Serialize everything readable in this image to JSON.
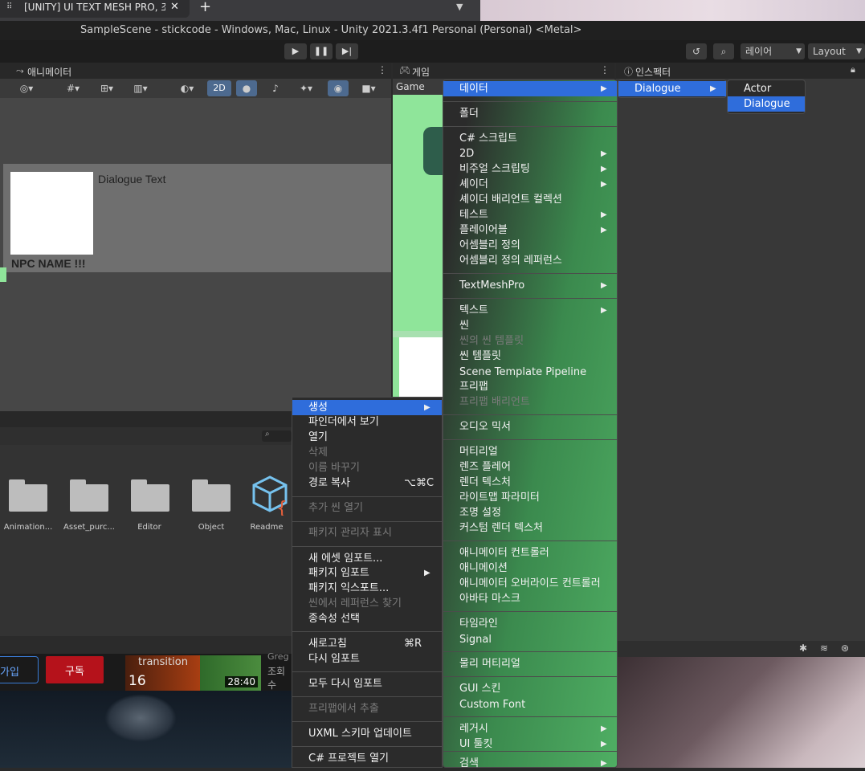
{
  "browser": {
    "tab_title": "[UNITY] UI TEXT MESH PRO, 조",
    "close_glyph": "✕",
    "new_tab_glyph": "+"
  },
  "window": {
    "title": "SampleScene - stickcode - Windows, Mac, Linux - Unity 2021.3.4f1 Personal (Personal) <Metal>"
  },
  "toolbar": {
    "layers_label": "레이어",
    "layout_label": "Layout"
  },
  "panels": {
    "animator_tab": "애니메이터",
    "game_tab": "게임",
    "game_sub": "Game",
    "inspector_tab": "인스펙터",
    "scene_2d": "2D"
  },
  "scene": {
    "dialogue_text": "Dialogue Text",
    "npc_name": "NPC NAME !!!"
  },
  "project": {
    "items": [
      {
        "label": "Animation..."
      },
      {
        "label": "Asset_purc..."
      },
      {
        "label": "Editor"
      },
      {
        "label": "Object"
      },
      {
        "label": "Readme"
      }
    ]
  },
  "video_strip": {
    "join": "가입",
    "subscribe": "구독",
    "transition": "transition",
    "count": "16",
    "duration": "28:40",
    "views": "조회수",
    "author": "Greg"
  },
  "context_menu": {
    "items": [
      {
        "label": "생성",
        "highlight": true,
        "arrow": true
      },
      {
        "label": "파인더에서 보기"
      },
      {
        "label": "열기"
      },
      {
        "label": "삭제",
        "disabled": true
      },
      {
        "label": "이름 바꾸기",
        "disabled": true
      },
      {
        "label": "경로 복사",
        "shortcut": "⌥⌘C"
      },
      {
        "label": "추가 씬 열기",
        "disabled": true
      },
      {
        "label": "패키지 관리자 표시",
        "disabled": true
      },
      {
        "label": "새 에셋 임포트..."
      },
      {
        "label": "패키지 임포트",
        "arrow": true
      },
      {
        "label": "패키지 익스포트..."
      },
      {
        "label": "씬에서 레퍼런스 찾기",
        "disabled": true
      },
      {
        "label": "종속성 선택"
      },
      {
        "label": "새로고침",
        "shortcut": "⌘R"
      },
      {
        "label": "다시 임포트"
      },
      {
        "label": "모두 다시 임포트"
      },
      {
        "label": "프리팹에서 추출",
        "disabled": true
      },
      {
        "label": "UXML 스키마 업데이트"
      },
      {
        "label": "C# 프로젝트 열기"
      }
    ]
  },
  "create_menu": {
    "items": [
      {
        "label": "데이터",
        "highlight": true,
        "arrow": true
      },
      {
        "label": "폴더"
      },
      {
        "label": "C# 스크립트"
      },
      {
        "label": "2D",
        "arrow": true
      },
      {
        "label": "비주얼 스크립팅",
        "arrow": true
      },
      {
        "label": "셰이더",
        "arrow": true
      },
      {
        "label": "셰이더 배리언트 컬렉션"
      },
      {
        "label": "테스트",
        "arrow": true
      },
      {
        "label": "플레이어블",
        "arrow": true
      },
      {
        "label": "어셈블리 정의"
      },
      {
        "label": "어셈블리 정의 레퍼런스"
      },
      {
        "label": "TextMeshPro",
        "arrow": true
      },
      {
        "label": "텍스트",
        "arrow": true
      },
      {
        "label": "씬"
      },
      {
        "label": "씬의 씬 템플릿",
        "disabled": true
      },
      {
        "label": "씬 템플릿"
      },
      {
        "label": "Scene Template Pipeline"
      },
      {
        "label": "프리팹"
      },
      {
        "label": "프리팹 배리언트",
        "disabled": true
      },
      {
        "label": "오디오 믹서"
      },
      {
        "label": "머티리얼"
      },
      {
        "label": "렌즈 플레어"
      },
      {
        "label": "렌더 텍스처"
      },
      {
        "label": "라이트맵 파라미터"
      },
      {
        "label": "조명 설정"
      },
      {
        "label": "커스텀 렌더 텍스처"
      },
      {
        "label": "애니메이터 컨트롤러"
      },
      {
        "label": "애니메이션"
      },
      {
        "label": "애니메이터 오버라이드 컨트롤러"
      },
      {
        "label": "아바타 마스크"
      },
      {
        "label": "타임라인"
      },
      {
        "label": "Signal"
      },
      {
        "label": "물리 머티리얼"
      },
      {
        "label": "GUI 스킨"
      },
      {
        "label": "Custom Font"
      },
      {
        "label": "레거시",
        "arrow": true
      },
      {
        "label": "UI 툴킷",
        "arrow": true
      },
      {
        "label": "검색",
        "arrow": true
      }
    ]
  },
  "data_menu": {
    "items": [
      {
        "label": "Dialogue",
        "highlight": true,
        "arrow": true
      }
    ]
  },
  "dialogue_menu": {
    "items": [
      {
        "label": "Actor"
      },
      {
        "label": "Dialogue",
        "highlight": true
      }
    ]
  },
  "colors": {
    "highlight": "#2f6ddb",
    "menu_bg": "#2b2b2b",
    "game_green": "#8fe59a"
  }
}
